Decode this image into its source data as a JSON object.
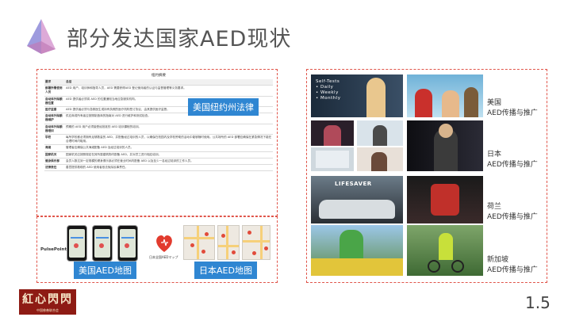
{
  "slide": {
    "title": "部分发达国家AED现状",
    "page_number": "1.5"
  },
  "law_section": {
    "label": "美国纽约州法律",
    "document": {
      "caption": "纽约摘要",
      "rows": [
        {
          "key": "要求",
          "value": "总结"
        },
        {
          "key": "部署所需使用人员",
          "value": "AED 用户、培训师和指导人员，AED 需要获得AED 登记使用者的认证与监督管理等义务要求。"
        },
        {
          "key": "自动体外除颤器位置",
          "value": "AED 提供者必须将 AED 的位置通知当地应急服务机构。"
        },
        {
          "key": "医疗监督",
          "value": "AED 提供者必须与急救医生或持有执照的医疗机构签订协议，由其提供医疗监督。"
        },
        {
          "key": "自动体外除颤器维护",
          "value": "供应商或所有者应按照制造商的指南对 AED 进行维护和测试检查。"
        },
        {
          "key": "自动体外除颤器培训",
          "value": "预期的 AED 用户必须接受经批准的 AED 培训课程的培训。"
        },
        {
          "key": "学校",
          "value": "每所学校都必须拥有足够数量的 AED，并配备经过培训的人员，以确保在校园内及学校赞助的活动中能够随时使用。公共场所的 AED 部署应确保在紧急情况下能在合理时间内取用。"
        },
        {
          "key": "海滩",
          "value": "管理者应确保公共海滩配备 AED 及经过培训的人员。"
        },
        {
          "key": "国家机关",
          "value": "国家机关应按照规定在其所属建筑物内配备 AED，并对员工进行相应培训。"
        },
        {
          "key": "健身俱乐部",
          "value": "会员人数达到一定规模的健身俱乐部必须在营业时间内配备 AED 以及至少一名经过培训的工作人员。"
        },
        {
          "key": "法律责任",
          "value": "善意提供救助的 AED 使用者依法免除民事责任。"
        }
      ]
    }
  },
  "map_section": {
    "us_label": "美国AED地图",
    "jp_label": "日本AED地图",
    "us_app_brand": "PulsePoint",
    "jp_app_caption": "日本全国AEDマップ"
  },
  "photo_section": {
    "captions": {
      "us_top": "Self-Tests\n• Daily\n• Weekly\n• Monthly",
      "nl_top": "LIFESAVER"
    },
    "countries": [
      {
        "name": "美国",
        "subtitle": "AED传播与推广"
      },
      {
        "name": "日本",
        "subtitle": "AED传播与推广"
      },
      {
        "name": "荷兰",
        "subtitle": "AED传播与推广"
      },
      {
        "name": "新加坡",
        "subtitle": "AED传播与推广"
      }
    ]
  },
  "brand": {
    "name": "紅心閃閃",
    "tagline": "中国慈善联合会"
  },
  "colors": {
    "accent_red": "#e0554a",
    "label_blue": "#2f86d2",
    "seal_red": "#8e1b14"
  }
}
